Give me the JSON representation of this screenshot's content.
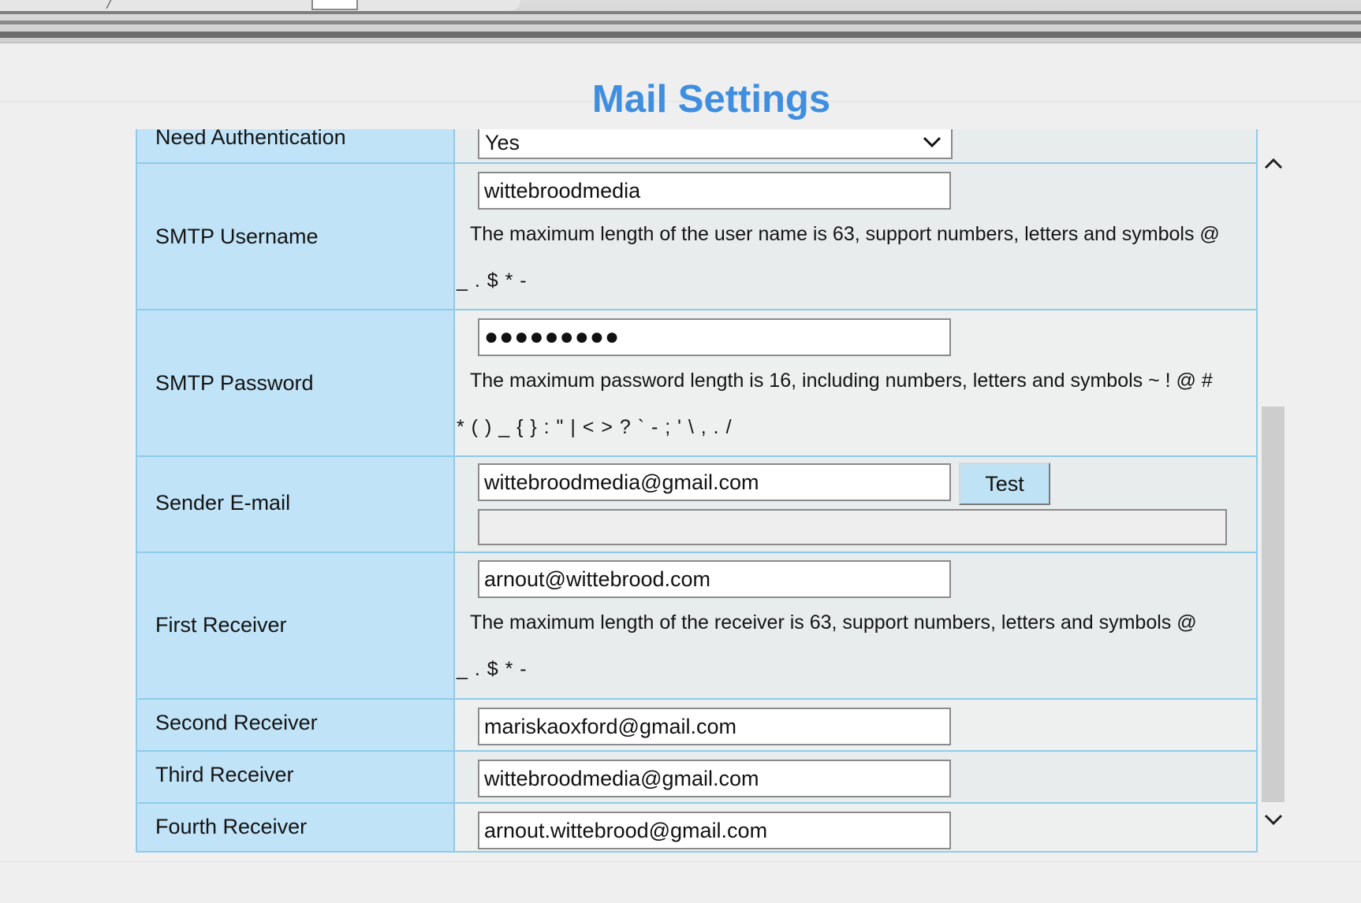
{
  "page": {
    "title": "Mail Settings"
  },
  "rows": {
    "need_auth": {
      "label": "Need Authentication",
      "selected": "Yes"
    },
    "smtp_username": {
      "label": "SMTP Username",
      "value": "wittebroodmedia",
      "hint_line1": "The maximum length of the user name is 63, support numbers, letters and symbols @",
      "hint_line2": "_ . $ * -"
    },
    "smtp_password": {
      "label": "SMTP Password",
      "value": "●●●●●●●●●",
      "hint_line1": "The maximum password length is 16, including numbers, letters and symbols ~ ! @ #",
      "hint_line2": "* ( ) _ { } : \" | < > ? ` - ; ' \\ , . /"
    },
    "sender_email": {
      "label": "Sender E-mail",
      "value": "wittebroodmedia@gmail.com",
      "test_button": "Test",
      "test_status": ""
    },
    "first_receiver": {
      "label": "First Receiver",
      "value": "arnout@wittebrood.com",
      "hint_line1": "The maximum length of the receiver is 63, support numbers, letters and symbols @",
      "hint_line2": "_ . $ * -"
    },
    "second_receiver": {
      "label": "Second Receiver",
      "value": "mariskaoxford@gmail.com"
    },
    "third_receiver": {
      "label": "Third Receiver",
      "value": "wittebroodmedia@gmail.com"
    },
    "fourth_receiver": {
      "label": "Fourth Receiver",
      "value": "arnout.wittebrood@gmail.com"
    }
  },
  "icons": {
    "select_arrow": "chevron-down-icon",
    "scroll_up": "chevron-up-icon",
    "scroll_down": "chevron-down-icon"
  },
  "colors": {
    "title": "#3f8ee0",
    "label_cell": "#c0e3f7",
    "border": "#8fcbe8",
    "button": "#bfe3f5"
  }
}
